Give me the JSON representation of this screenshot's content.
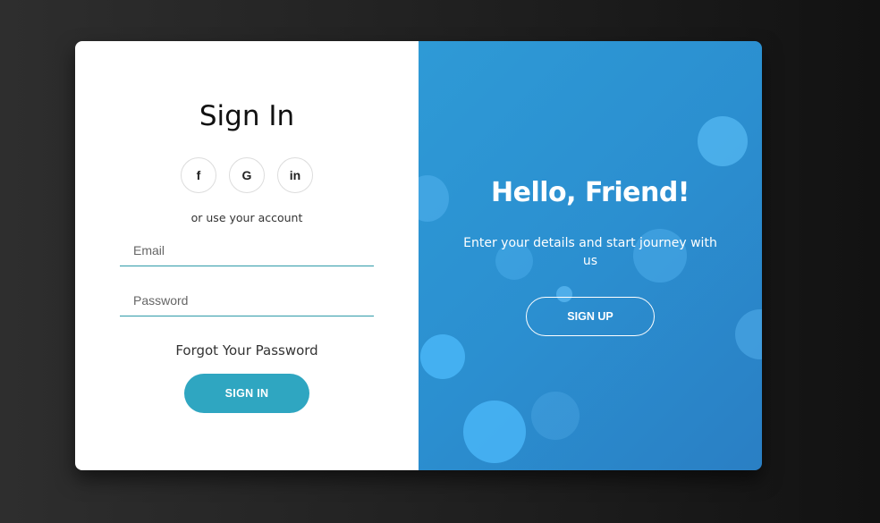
{
  "signin": {
    "title": "Sign In",
    "social": {
      "facebook_label": "f",
      "google_label": "G",
      "linkedin_label": "in"
    },
    "alt_text": "or use your account",
    "email_placeholder": "Email",
    "password_placeholder": "Password",
    "forgot_link": "Forgot Your Password",
    "button_label": "SIGN IN"
  },
  "overlay": {
    "title": "Hello, Friend!",
    "description": "Enter your details and start journey with us",
    "button_label": "SIGN UP"
  },
  "colors": {
    "accent": "#2fa6c1",
    "underline": "#2e9aa8",
    "panel_blue": "#2b8fd0",
    "bokeh": "#4db8ff"
  }
}
